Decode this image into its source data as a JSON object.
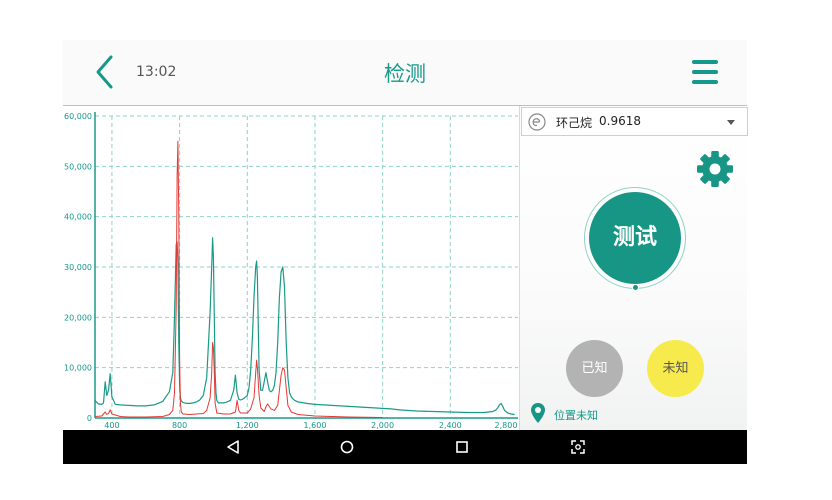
{
  "header": {
    "clock": "13:02",
    "title": "检测"
  },
  "chart_data": {
    "type": "line",
    "xlim": [
      300,
      2800
    ],
    "ylim": [
      0,
      60000
    ],
    "x_ticks": [
      400,
      800,
      1200,
      1600,
      2000,
      2400,
      2800
    ],
    "x_tick_labels": [
      "400",
      "800",
      "1,200",
      "1,600",
      "2,000",
      "2,400",
      "2,800"
    ],
    "y_ticks": [
      0,
      10000,
      20000,
      30000,
      40000,
      50000,
      60000
    ],
    "y_tick_labels": [
      "0",
      "10,000",
      "20,000",
      "30,000",
      "40,000",
      "50,000",
      "60,000"
    ],
    "grid": true,
    "series": [
      {
        "color": "#1a9a88",
        "x": [
          300,
          320,
          340,
          350,
          360,
          370,
          380,
          390,
          400,
          420,
          450,
          500,
          550,
          600,
          650,
          700,
          740,
          760,
          770,
          780,
          785,
          790,
          795,
          800,
          805,
          810,
          820,
          840,
          860,
          880,
          900,
          920,
          940,
          960,
          980,
          990,
          995,
          1000,
          1005,
          1010,
          1015,
          1020,
          1030,
          1060,
          1080,
          1100,
          1120,
          1130,
          1140,
          1150,
          1160,
          1170,
          1180,
          1200,
          1210,
          1220,
          1230,
          1240,
          1250,
          1255,
          1260,
          1265,
          1270,
          1280,
          1290,
          1300,
          1310,
          1320,
          1330,
          1340,
          1350,
          1360,
          1370,
          1380,
          1390,
          1400,
          1410,
          1420,
          1430,
          1440,
          1450,
          1460,
          1470,
          1480,
          1500,
          1550,
          1600,
          1650,
          1700,
          1750,
          1800,
          1850,
          1900,
          1950,
          2000,
          2050,
          2100,
          2200,
          2300,
          2400,
          2500,
          2600,
          2650,
          2670,
          2680,
          2690,
          2700,
          2710,
          2720,
          2740,
          2760,
          2780
        ],
        "values": [
          3500,
          2800,
          2700,
          3000,
          7200,
          4500,
          5500,
          8800,
          4200,
          2700,
          2600,
          2500,
          2400,
          2400,
          2600,
          3300,
          5200,
          9000,
          20000,
          34500,
          35000,
          31000,
          15000,
          6500,
          4000,
          3400,
          3100,
          2900,
          2900,
          3000,
          3200,
          3600,
          4500,
          8000,
          21000,
          30000,
          35800,
          32000,
          20000,
          9000,
          5000,
          3500,
          3000,
          3000,
          3200,
          3500,
          5500,
          8500,
          5000,
          3700,
          3600,
          3700,
          3900,
          4500,
          6000,
          9500,
          16000,
          24000,
          30000,
          31200,
          28000,
          18000,
          9500,
          5500,
          5500,
          7200,
          9000,
          7200,
          5500,
          5200,
          5500,
          6500,
          9000,
          15000,
          24000,
          29000,
          30000,
          26000,
          15000,
          8000,
          5000,
          4200,
          3800,
          3500,
          3200,
          2900,
          2700,
          2600,
          2500,
          2400,
          2300,
          2200,
          2100,
          2000,
          1900,
          1800,
          1600,
          1400,
          1300,
          1200,
          1100,
          1100,
          1300,
          1600,
          2000,
          2600,
          2900,
          2300,
          1500,
          1000,
          800,
          700
        ]
      },
      {
        "color": "#e53935",
        "x": [
          300,
          340,
          360,
          370,
          380,
          390,
          400,
          450,
          500,
          600,
          700,
          740,
          760,
          770,
          780,
          785,
          790,
          795,
          800,
          805,
          810,
          820,
          860,
          900,
          940,
          960,
          980,
          990,
          995,
          1000,
          1005,
          1010,
          1020,
          1060,
          1100,
          1130,
          1140,
          1150,
          1160,
          1200,
          1220,
          1240,
          1250,
          1255,
          1260,
          1270,
          1280,
          1300,
          1310,
          1320,
          1340,
          1360,
          1380,
          1390,
          1400,
          1410,
          1420,
          1430,
          1440,
          1460,
          1500,
          1600,
          1700,
          1800,
          1900,
          2000
        ],
        "values": [
          300,
          400,
          1200,
          700,
          900,
          1600,
          800,
          300,
          200,
          200,
          300,
          700,
          1500,
          5000,
          22000,
          48000,
          55000,
          40000,
          12000,
          3000,
          1200,
          800,
          700,
          800,
          900,
          1500,
          4000,
          9000,
          15000,
          14000,
          9000,
          3000,
          1000,
          800,
          800,
          1200,
          3500,
          1500,
          1000,
          1000,
          1800,
          4000,
          9000,
          11500,
          10000,
          4500,
          2000,
          1300,
          2200,
          2800,
          1800,
          1500,
          2500,
          5500,
          8500,
          10000,
          9500,
          6000,
          2500,
          1200,
          700,
          400,
          300,
          200,
          150,
          100
        ]
      }
    ]
  },
  "selector": {
    "icon": "ethanol-circle-icon",
    "name": "环己烷",
    "value": "0.9618"
  },
  "actions": {
    "test_label": "测试",
    "known_label": "已知",
    "unknown_label": "未知"
  },
  "location": {
    "text": "位置未知"
  },
  "colors": {
    "accent": "#179585",
    "series_primary": "#1a9a88",
    "series_secondary": "#e53935",
    "known": "#b3b3b3",
    "unknown": "#f7ea4c"
  }
}
